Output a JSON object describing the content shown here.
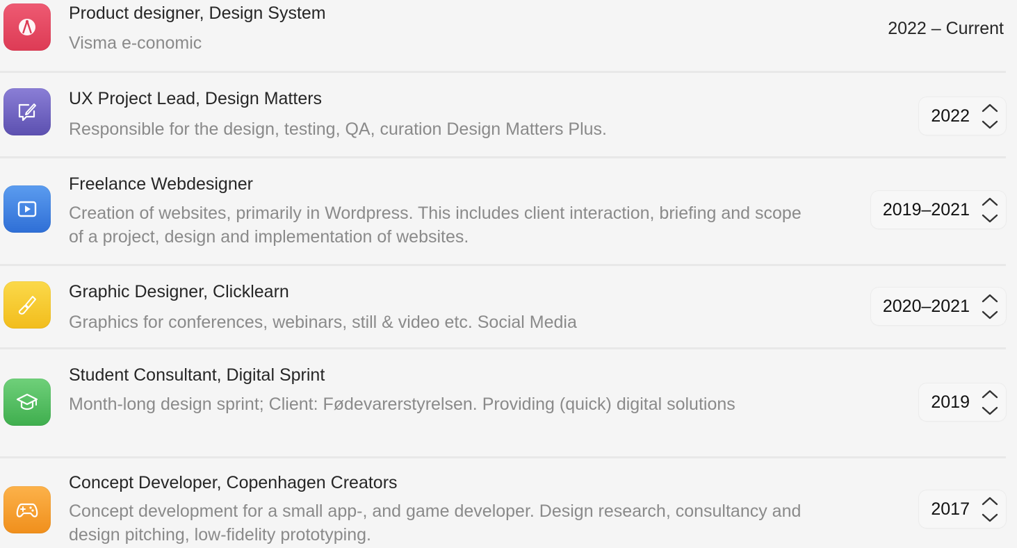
{
  "entries": [
    {
      "title": "Product designer, Design System",
      "description": "Visma e-conomic",
      "period": "2022 – Current",
      "icon": "compass-icon",
      "icon_colors": [
        "#ee5a72",
        "#dd3b55"
      ]
    },
    {
      "title": "UX Project Lead, Design Matters",
      "description": "Responsible for the design, testing, QA, curation Design Matters Plus.",
      "period": "2022",
      "icon": "message-edit-icon",
      "icon_colors": [
        "#8a7ed6",
        "#5c50b0"
      ]
    },
    {
      "title": "Freelance Webdesigner",
      "description": "Creation of websites, primarily in Wordpress. This includes client interaction, briefing and scope of a project, design and implementation of websites.",
      "period": "2019–2021",
      "icon": "play-window-icon",
      "icon_colors": [
        "#5b9cef",
        "#2f6fd6"
      ]
    },
    {
      "title": "Graphic Designer, Clicklearn",
      "description": "Graphics for conferences, webinars, still & video etc. Social Media",
      "period": "2020–2021",
      "icon": "paintbrush-icon",
      "icon_colors": [
        "#fbd94a",
        "#f2bd1c"
      ]
    },
    {
      "title": "Student Consultant, Digital Sprint",
      "description": "Month-long design sprint; Client: Fødevarerstyrelsen. Providing (quick) digital solutions",
      "period": "2019",
      "icon": "graduation-cap-icon",
      "icon_colors": [
        "#6fd07a",
        "#3fae4e"
      ]
    },
    {
      "title": "Concept Developer, Copenhagen Creators",
      "description": "Concept development for a small app-, and game developer. Design research, consultancy and design pitching, low-fidelity prototyping.",
      "period": "2017",
      "icon": "game-controller-icon",
      "icon_colors": [
        "#fcb24a",
        "#f08f1c"
      ]
    }
  ]
}
